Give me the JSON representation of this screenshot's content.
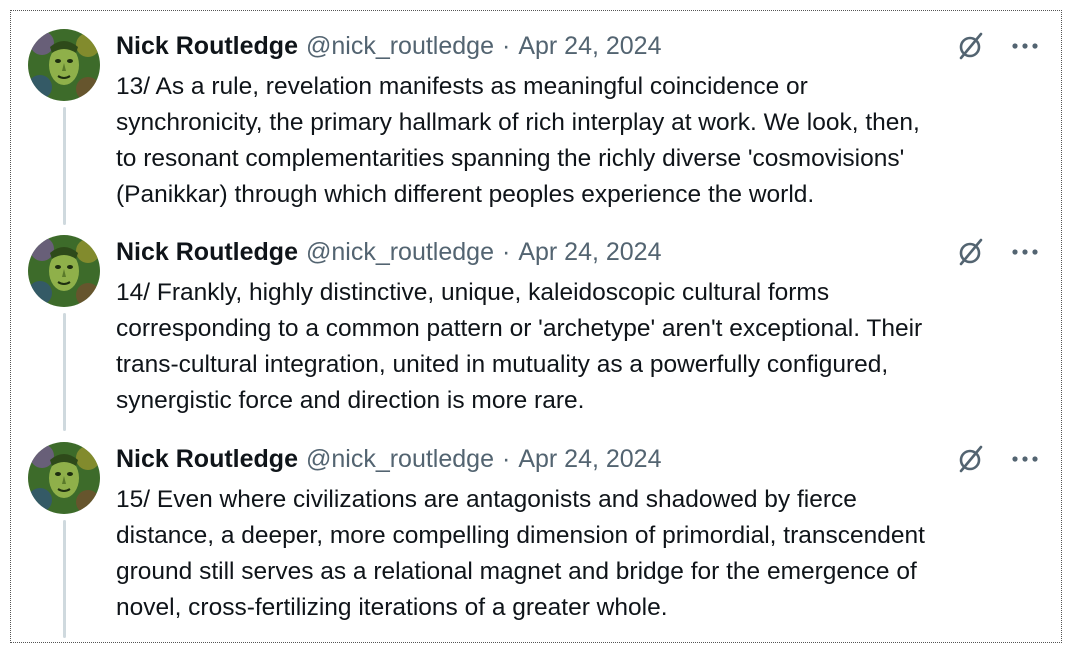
{
  "tweets": [
    {
      "name": "Nick Routledge",
      "handle": "@nick_routledge",
      "separator": "·",
      "date": "Apr 24, 2024",
      "lines": [
        "13/ As a rule, revelation manifests as meaningful coincidence or",
        "synchronicity, the primary hallmark of rich interplay at work. We look, then,",
        "to resonant complementarities spanning the richly diverse 'cosmovisions'",
        "(Panikkar) through which different peoples experience the world."
      ]
    },
    {
      "name": "Nick Routledge",
      "handle": "@nick_routledge",
      "separator": "·",
      "date": "Apr 24, 2024",
      "lines": [
        "14/ Frankly, highly distinctive, unique, kaleidoscopic cultural forms",
        "corresponding to a common pattern or 'archetype' aren't exceptional. Their",
        "trans-cultural integration, united in mutuality as a powerfully configured,",
        "synergistic force and direction is more rare."
      ]
    },
    {
      "name": "Nick Routledge",
      "handle": "@nick_routledge",
      "separator": "·",
      "date": "Apr 24, 2024",
      "lines": [
        "15/ Even where civilizations are antagonists and shadowed by fierce",
        "distance, a deeper, more compelling dimension of primordial, transcendent",
        "ground still serves as a relational magnet and bridge for the emergence of",
        "novel, cross-fertilizing iterations of a greater whole."
      ]
    }
  ],
  "icons": {
    "grok": "grok-icon",
    "more": "more-icon"
  },
  "colors": {
    "text": "#0f1419",
    "secondary": "#536471",
    "thread_line": "#cfd9de"
  }
}
